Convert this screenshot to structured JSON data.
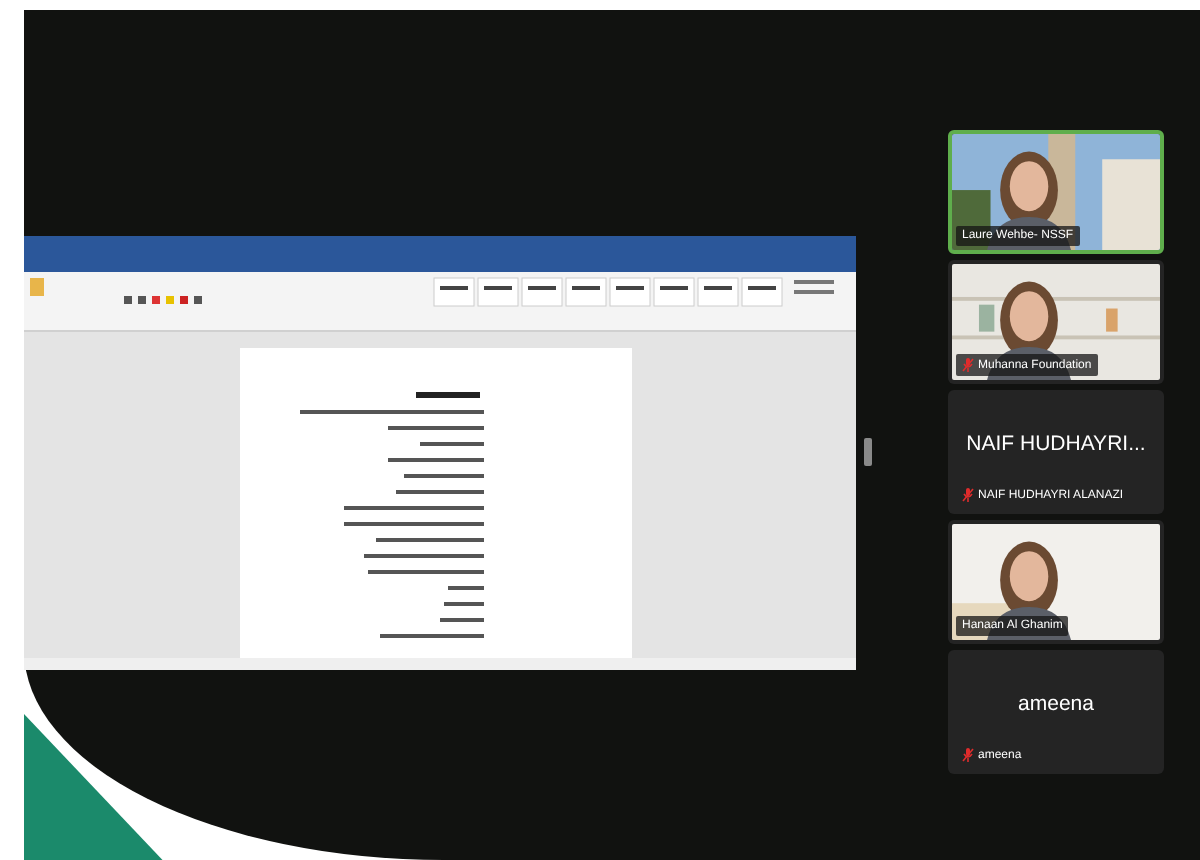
{
  "shared_screen": {
    "kind": "document"
  },
  "participants": [
    {
      "kind": "video",
      "label": "Laure Wehbe- NSSF",
      "muted": false,
      "selected": true
    },
    {
      "kind": "video",
      "label": "Muhanna Foundation",
      "muted": true,
      "selected": false
    },
    {
      "kind": "name",
      "big_name": "NAIF HUDHAYRI...",
      "label": "NAIF HUDHAYRI ALANAZI",
      "muted": true,
      "selected": false
    },
    {
      "kind": "video",
      "label": "Hanaan Al Ghanim",
      "muted": false,
      "selected": false
    },
    {
      "kind": "name",
      "big_name": "ameena",
      "label": "ameena",
      "muted": true,
      "selected": false
    }
  ]
}
